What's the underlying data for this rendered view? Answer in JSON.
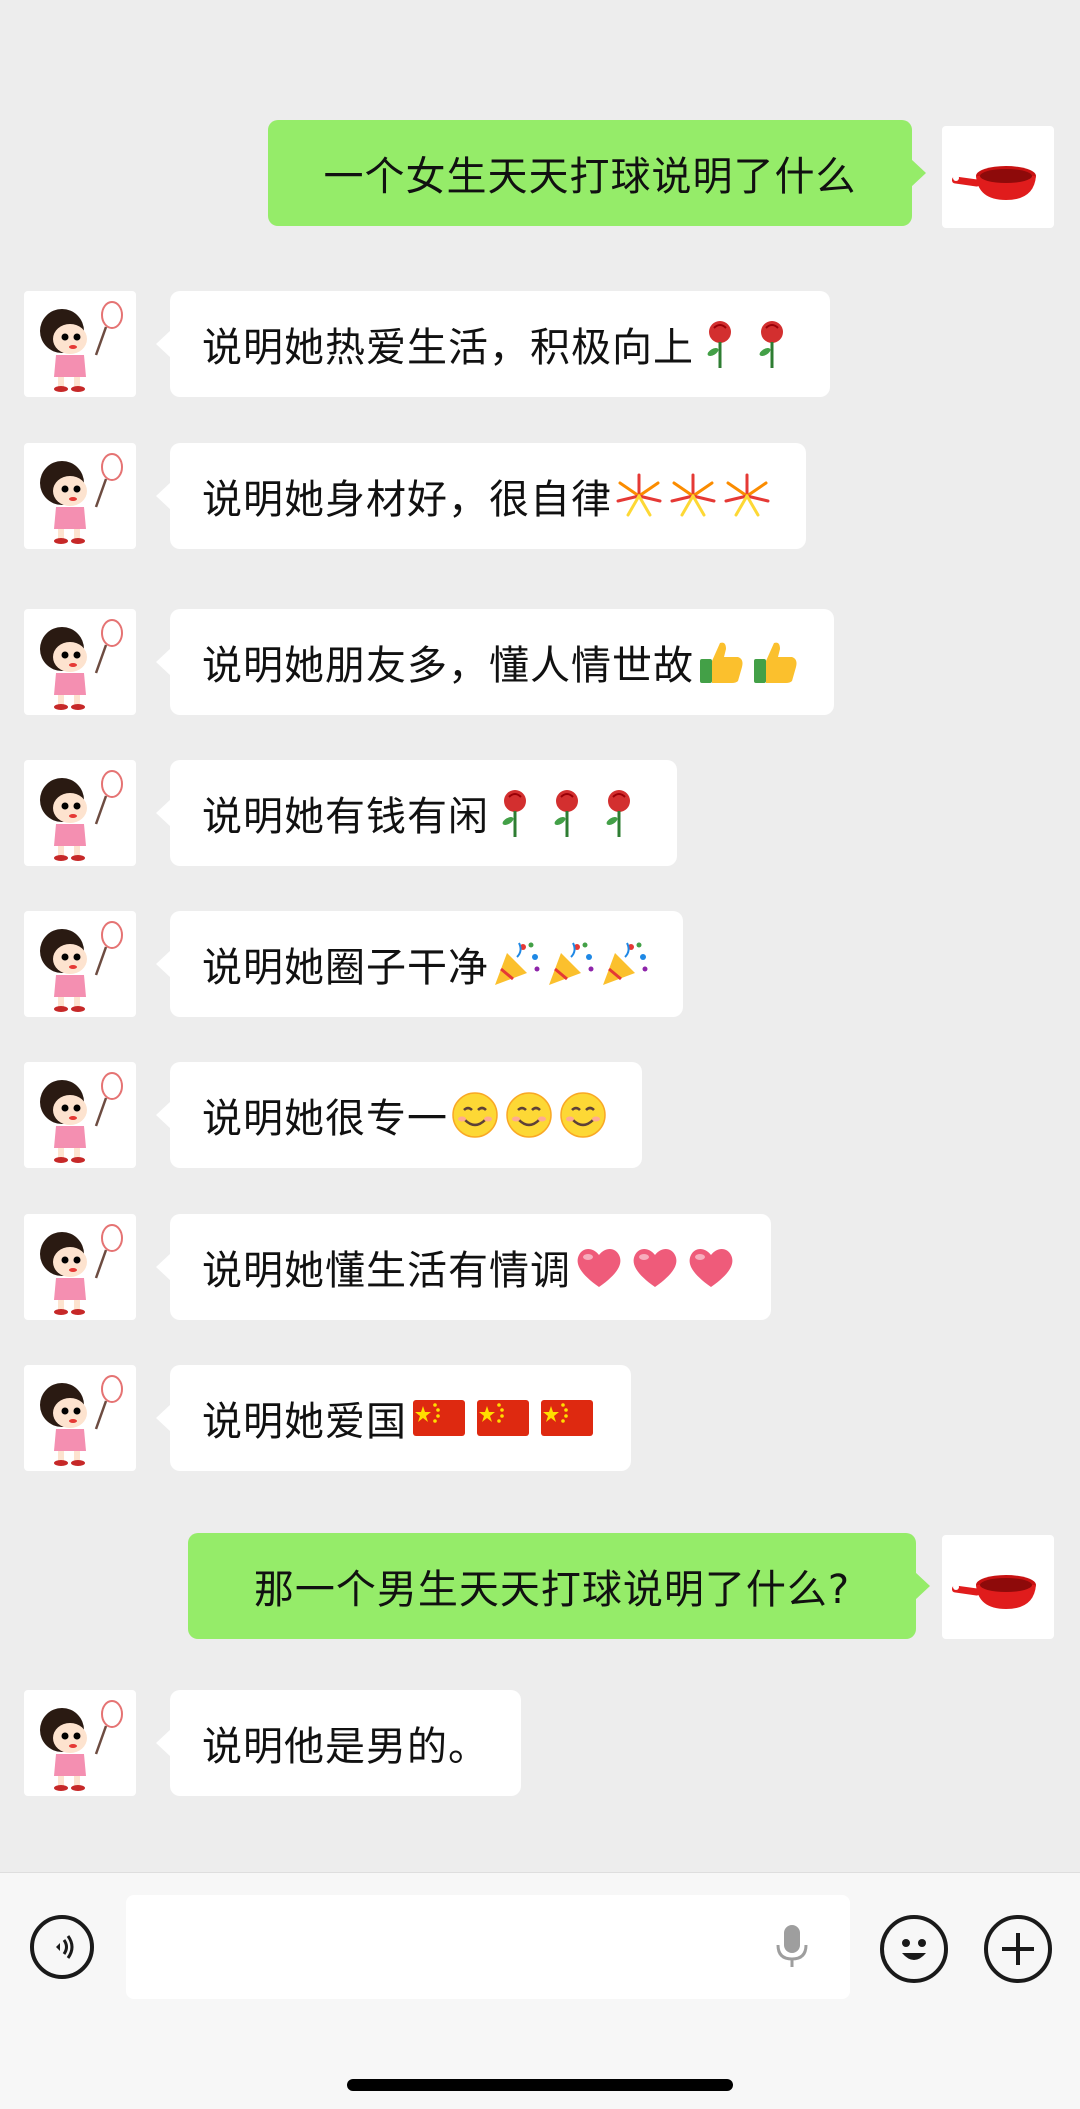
{
  "messages": [
    {
      "side": "out",
      "text": "一个女生天天打球说明了什么",
      "emoji": []
    },
    {
      "side": "in",
      "text": "说明她热爱生活，积极向上",
      "emoji": [
        "rose",
        "rose"
      ]
    },
    {
      "side": "in",
      "text": "说明她身材好，很自律",
      "emoji": [
        "firework",
        "firework",
        "firework"
      ]
    },
    {
      "side": "in",
      "text": "说明她朋友多，懂人情世故",
      "emoji": [
        "thumbs-up",
        "thumbs-up"
      ]
    },
    {
      "side": "in",
      "text": "说明她有钱有闲",
      "emoji": [
        "rose",
        "rose",
        "rose"
      ]
    },
    {
      "side": "in",
      "text": "说明她圈子干净",
      "emoji": [
        "party-popper",
        "party-popper",
        "party-popper"
      ]
    },
    {
      "side": "in",
      "text": "说明她很专一",
      "emoji": [
        "smile",
        "smile",
        "smile"
      ]
    },
    {
      "side": "in",
      "text": "说明她懂生活有情调",
      "emoji": [
        "heart",
        "heart",
        "heart"
      ]
    },
    {
      "side": "in",
      "text": "说明她爱国",
      "emoji": [
        "china-flag",
        "china-flag",
        "china-flag"
      ]
    },
    {
      "side": "out",
      "text": "那一个男生天天打球说明了什么?",
      "emoji": []
    },
    {
      "side": "in",
      "text": "说明他是男的。",
      "emoji": []
    }
  ],
  "colors": {
    "background": "#ededed",
    "outgoing_bubble": "#95ec69",
    "incoming_bubble": "#ffffff"
  },
  "avatars": {
    "self": "red-saucepan-icon",
    "other": "cartoon-girl-badminton-icon"
  },
  "input_bar": {
    "left_icon": "voice-icon",
    "mic_icon": "microphone-icon",
    "emoji_icon": "emoji-icon",
    "more_icon": "plus-icon"
  }
}
